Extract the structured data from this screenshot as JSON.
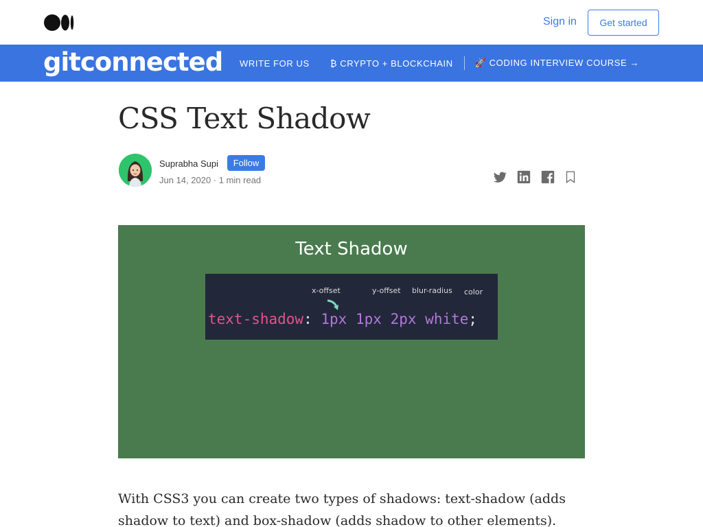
{
  "header": {
    "logo_icon": "medium-logo-icon",
    "sign_in": "Sign in",
    "get_started": "Get started"
  },
  "publication": {
    "name": "gitconnected",
    "nav": [
      {
        "label": "WRITE FOR US"
      },
      {
        "label": "₿ CRYPTO + BLOCKCHAIN"
      },
      {
        "label": "🚀 CODING INTERVIEW COURSE →"
      }
    ],
    "color": "#3a74e0"
  },
  "article": {
    "title": "CSS Text Shadow",
    "author": "Suprabha Supi",
    "follow": "Follow",
    "meta": "Jun 14, 2020 · 1 min read",
    "share_icons": [
      "twitter-icon",
      "linkedin-icon",
      "facebook-icon",
      "bookmark-icon"
    ],
    "hero": {
      "title": "Text Shadow",
      "labels": {
        "x_offset": "x-offset",
        "y_offset": "y-offset",
        "blur_radius": "blur-radius",
        "color": "color"
      },
      "code": {
        "property": "text-shadow",
        "colon": ":",
        "v1": "1px",
        "v2": "1px",
        "v3": "2px",
        "v4": "white",
        "semi": ";"
      },
      "bg_color": "#4a7b4e"
    },
    "body": "With CSS3 you can create two types of shadows: text-shadow (adds shadow to text) and box-shadow (adds shadow to other elements)."
  }
}
